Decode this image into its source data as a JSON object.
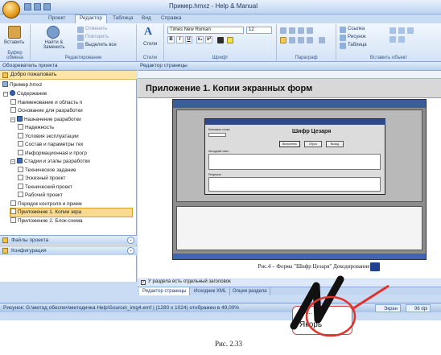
{
  "window": {
    "title": "Пример.hmxz - Help & Manual"
  },
  "tabs": [
    "Проект",
    "Редактор",
    "Таблица",
    "Вид",
    "Справка"
  ],
  "active_tab": "Редактор",
  "ribbon": {
    "clipboard": {
      "paste": "Вставить",
      "group": "Буфер обмена"
    },
    "editing": {
      "find": "Найти & Заменить",
      "undo": "Отменить",
      "redo": "Повторить",
      "select_all": "Выделить все",
      "group": "Редактирование"
    },
    "styles": {
      "label": "Стили",
      "group": "Стили"
    },
    "font": {
      "name": "Times New Roman",
      "size": "12",
      "group": "Шрифт",
      "bold": "B",
      "italic": "I",
      "underline": "U",
      "sub": "x₂",
      "sup": "x²"
    },
    "paragraph": {
      "group": "Параграф"
    },
    "insert": {
      "link": "Ссылка",
      "picture": "Рисунок",
      "table": "Таблица",
      "group": "Вставить объект"
    }
  },
  "sidebar": {
    "header": "Обозреватель проекта",
    "welcome": "Добро пожаловать",
    "root": "Пример.hmxz",
    "items": [
      {
        "label": "Содержание",
        "icon": "help-icon",
        "level": 1,
        "toggle": "−"
      },
      {
        "label": "Наименование и область п",
        "icon": "page-icon",
        "level": 2
      },
      {
        "label": "Основание для разработки",
        "icon": "page-icon",
        "level": 2
      },
      {
        "label": "Назначение разработки",
        "icon": "book-icon",
        "level": 2,
        "toggle": "−"
      },
      {
        "label": "Надежность",
        "icon": "page-icon",
        "level": 3
      },
      {
        "label": "Условия эксплуатации",
        "icon": "page-icon",
        "level": 3
      },
      {
        "label": "Состав и параметры тех",
        "icon": "page-icon",
        "level": 3
      },
      {
        "label": "Информационная и прогр",
        "icon": "page-icon",
        "level": 3
      },
      {
        "label": "Стадии и этапы разработки",
        "icon": "book-icon",
        "level": 2,
        "toggle": "−"
      },
      {
        "label": "Техническое задание",
        "icon": "page-icon",
        "level": 3
      },
      {
        "label": "Эскизный проект",
        "icon": "page-icon",
        "level": 3
      },
      {
        "label": "Технический проект",
        "icon": "page-icon",
        "level": 3
      },
      {
        "label": "Рабочий проект",
        "icon": "page-icon",
        "level": 3
      },
      {
        "label": "Порядок контроля и прием",
        "icon": "page-icon",
        "level": 2
      },
      {
        "label": "Приложение 1. Копии экра",
        "icon": "page-icon",
        "level": 2,
        "selected": true
      },
      {
        "label": "Приложение 2. Блок-схема",
        "icon": "page-icon",
        "level": 2
      }
    ],
    "panels": [
      "Файлы проекта",
      "Конфигурация"
    ]
  },
  "editor": {
    "header": "Редактор страницы",
    "topic_title": "Приложение 1. Копии экранных форм",
    "caption": "Рис.4 – Форма \"Шифр Цезаря\" Декодирование",
    "checkbox_label": "У раздела есть отдельный заголовок",
    "bottom_tabs": [
      "Редактор страницы",
      "Исходник XML",
      "Опции раздела"
    ]
  },
  "embedded_form": {
    "title": "Шифр Цезаря",
    "key_label": "Ключевое слово",
    "source_label": "Исходный текст",
    "result_label": "Результат",
    "buttons": [
      "Выполнить",
      "Сброс",
      "Выход"
    ]
  },
  "status": {
    "text": "Рисунок: G:\\метод обеспеч\\методичка Help\\Source\\_img4.emf | (1280 x 1024) отображен в 49,00%",
    "buttons": [
      "Экран",
      "96 dpi"
    ]
  },
  "overlay": {
    "handwriting": "И",
    "tooltip_line1": "Эк...",
    "tooltip_line2": "Якорь",
    "figure_caption": "Рис. 2.33"
  },
  "colors": {
    "ribbon": "#d3e3f6",
    "selection": "#fbd98e",
    "annotation": "#e0332b"
  }
}
